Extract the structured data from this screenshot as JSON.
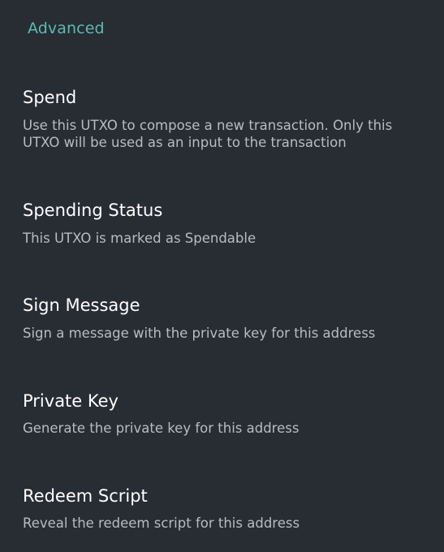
{
  "section": {
    "title": "Advanced"
  },
  "items": [
    {
      "title": "Spend",
      "summary": "Use this UTXO to compose a new transaction. Only this UTXO will be used as an input to the transaction"
    },
    {
      "title": "Spending Status",
      "summary": "This UTXO is marked as Spendable"
    },
    {
      "title": "Sign Message",
      "summary": "Sign a message with the private key for this address"
    },
    {
      "title": "Private Key",
      "summary": "Generate the private key for this address"
    },
    {
      "title": "Redeem Script",
      "summary": "Reveal the redeem script for this address"
    }
  ],
  "colors": {
    "background": "#282c33",
    "accent": "#5bbcb0",
    "title": "#ffffff",
    "summary": "#b9bcc1"
  }
}
